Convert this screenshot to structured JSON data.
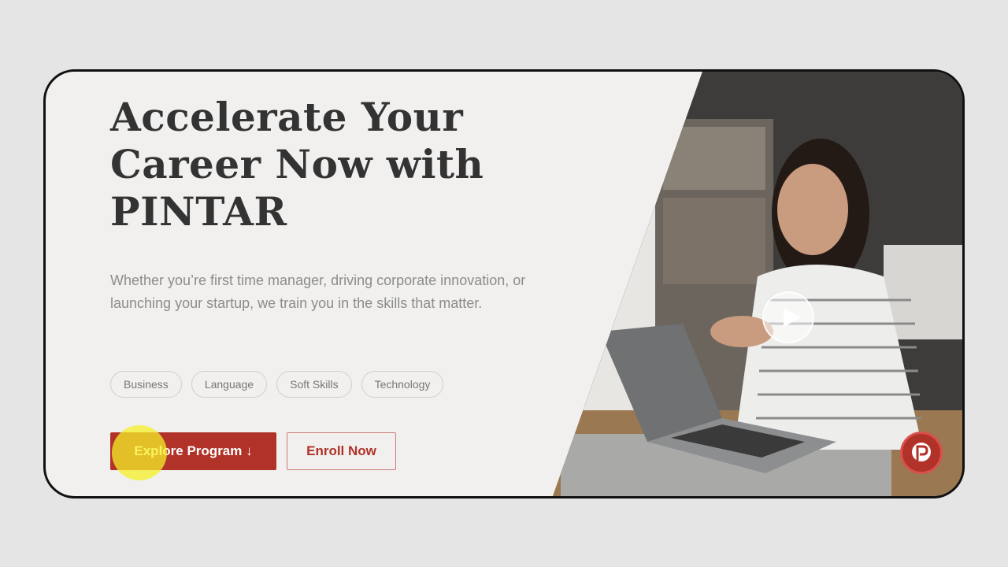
{
  "hero": {
    "title": "Accelerate Your Career Now with PINTAR",
    "description": "Whether you’re first time manager, driving corporate innovation, or launching your startup, we train you in the skills that matter."
  },
  "tags": [
    "Business",
    "Language",
    "Soft Skills",
    "Technology"
  ],
  "buttons": {
    "explore_label": "Explore Program ↓",
    "enroll_label": "Enroll Now"
  },
  "icons": {
    "play": "play-icon",
    "chat": "pintar-chat-icon"
  },
  "colors": {
    "brand_red": "#b03228",
    "title_text": "#333333",
    "muted_text": "#8c8c8c",
    "background": "#f1f0ee"
  }
}
